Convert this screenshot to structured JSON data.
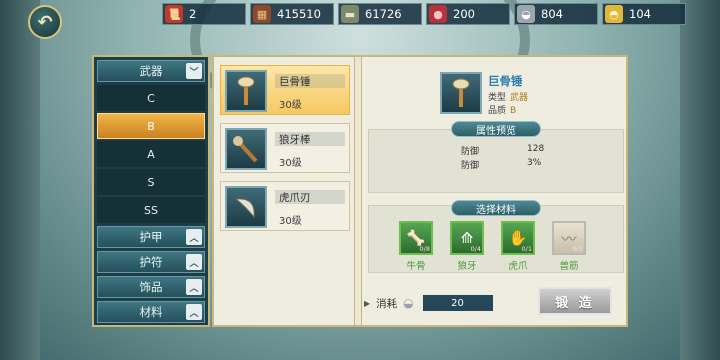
{
  "resources": [
    {
      "icon": "scroll-icon",
      "glyph": "📜",
      "color": "#c0392b",
      "value": "2"
    },
    {
      "icon": "wood-icon",
      "glyph": "▦",
      "color": "#8b4a2b",
      "value": "415510"
    },
    {
      "icon": "stone-icon",
      "glyph": "▬",
      "color": "#7a8a6a",
      "value": "61726"
    },
    {
      "icon": "meat-icon",
      "glyph": "●",
      "color": "#b8323a",
      "value": "200"
    },
    {
      "icon": "silver-icon",
      "glyph": "◒",
      "color": "#9aa7ad",
      "value": "804"
    },
    {
      "icon": "gold-icon",
      "glyph": "◓",
      "color": "#e0b73a",
      "value": "104"
    }
  ],
  "categories": {
    "weapon": "武器",
    "grades": [
      "C",
      "B",
      "A",
      "S",
      "SS"
    ],
    "selected_grade": "B",
    "others": [
      "护甲",
      "护符",
      "饰品",
      "材料"
    ]
  },
  "items": [
    {
      "name": "巨骨锤",
      "level": "30级",
      "icon": "bone-hammer-icon",
      "selected": true
    },
    {
      "name": "狼牙棒",
      "level": "30级",
      "icon": "wolf-tooth-club-icon",
      "selected": false
    },
    {
      "name": "虎爪刃",
      "level": "30级",
      "icon": "tiger-claw-blade-icon",
      "selected": false
    }
  ],
  "detail": {
    "name": "巨骨锤",
    "type_label": "类型",
    "type_value": "武器",
    "quality_label": "品质",
    "quality_value": "B",
    "attr_title": "属性预览",
    "attrs": [
      {
        "name": "防御",
        "value": "128"
      },
      {
        "name": "防御",
        "value": "3%"
      }
    ],
    "materials_title": "选择材料",
    "materials": [
      {
        "name": "牛骨",
        "count": "0/8",
        "icon": "ox-bone-icon",
        "glyph": "🦴",
        "available": true
      },
      {
        "name": "狼牙",
        "count": "0/4",
        "icon": "wolf-fang-icon",
        "glyph": "⟰",
        "available": true
      },
      {
        "name": "虎爪",
        "count": "0/1",
        "icon": "tiger-claw-icon",
        "glyph": "✋",
        "available": true
      },
      {
        "name": "兽筋",
        "count": "0/1",
        "icon": "beast-tendon-icon",
        "glyph": "〰",
        "available": false
      }
    ],
    "cost_label": "消耗",
    "cost_value": "20",
    "forge_label": "锻 造"
  }
}
